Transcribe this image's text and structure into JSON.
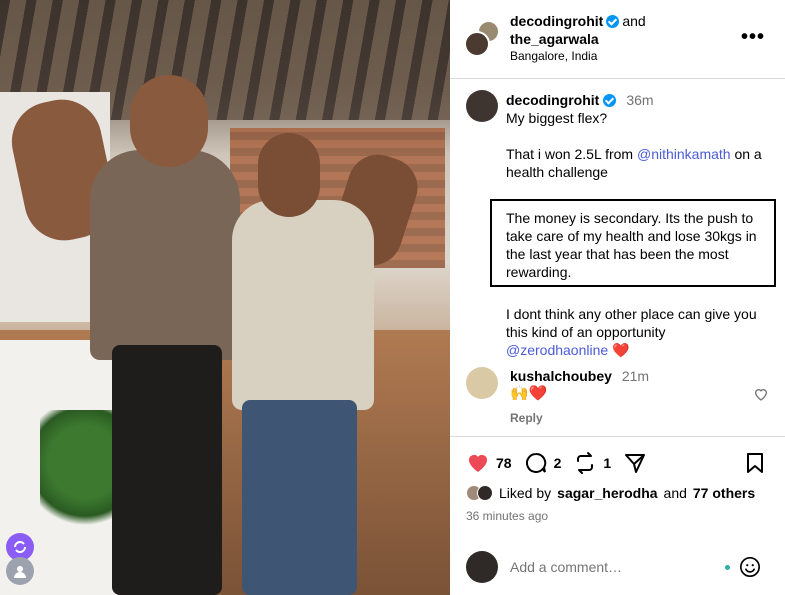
{
  "header": {
    "author": "decodingrohit",
    "and_text": "and",
    "collaborator": "the_agarwala",
    "location": "Bangalore, India",
    "more_icon": "more-horizontal-icon"
  },
  "post": {
    "author": "decodingrohit",
    "time": "36m",
    "lines": {
      "p1": "My biggest flex?",
      "p2_prefix": "That i won 2.5L from ",
      "p2_mention": "@nithinkamath",
      "p2_suffix": " on a health challenge",
      "p3": "The money is secondary. Its the push to take care of my health and lose 30kgs in the last year that has been the most rewarding.",
      "p4": "I dont think any other place can give you this kind of an opportunity",
      "p4_mention": "@zerodhaonline",
      "p4_emoji": "❤️"
    }
  },
  "comment": {
    "author": "kushalchoubey",
    "time": "21m",
    "text": "🙌❤️",
    "reply": "Reply"
  },
  "actions": {
    "likes_count": "78",
    "comments_count": "2",
    "reposts_count": "1",
    "liked_by_prefix": "Liked by",
    "liked_by_user": "sagar_herodha",
    "liked_by_and": "and",
    "liked_by_others": "77 others",
    "time_ago": "36 minutes ago",
    "like_color": "#ed4956"
  },
  "comment_input": {
    "placeholder": "Add a comment…"
  }
}
